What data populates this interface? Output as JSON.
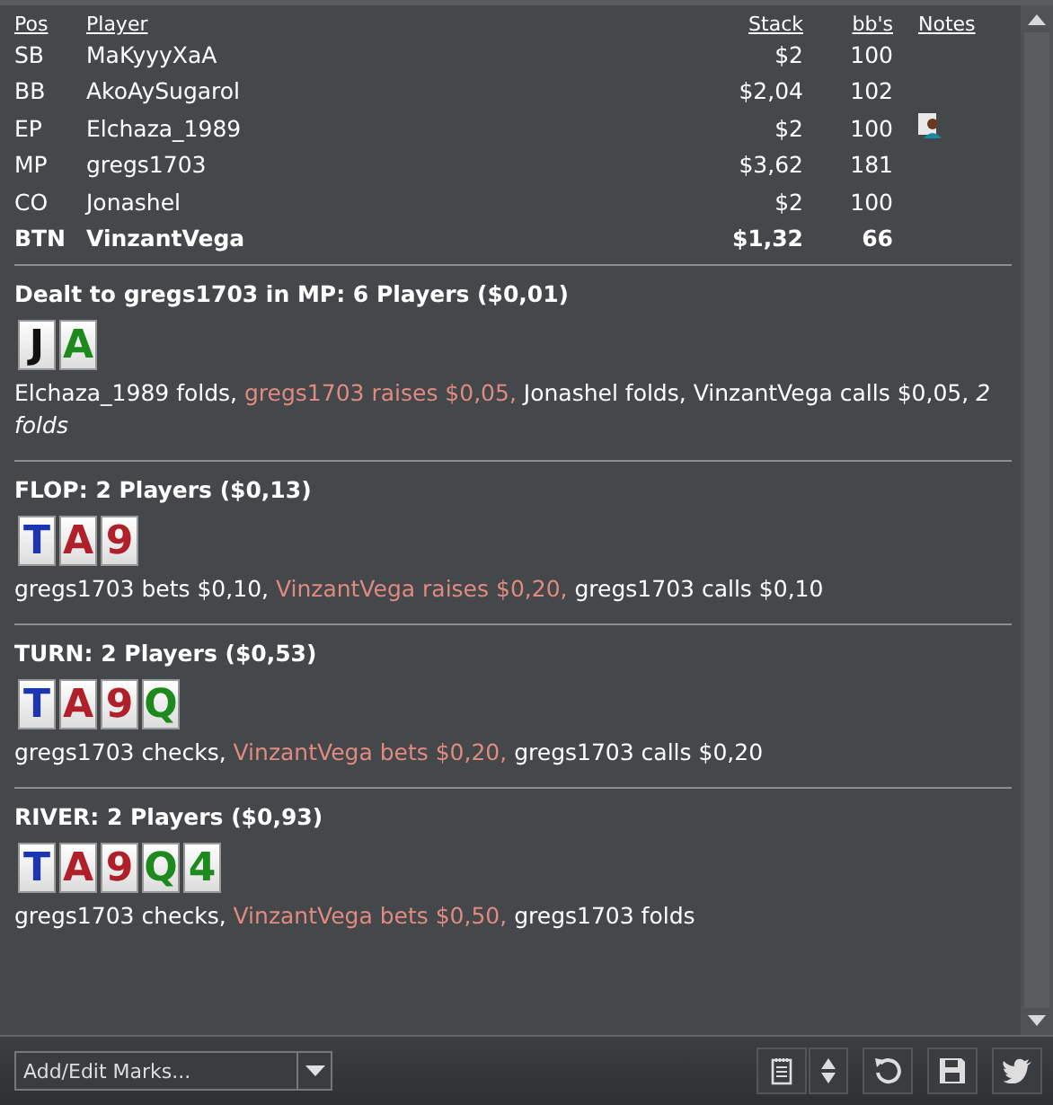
{
  "players": {
    "columns": [
      "Pos",
      "Player",
      "Stack",
      "bb's",
      "Notes"
    ],
    "rows": [
      {
        "pos": "SB",
        "player": "MaKyyyXaA",
        "stack": "$2",
        "bbs": "100",
        "has_note": false,
        "bold": false
      },
      {
        "pos": "BB",
        "player": "AkoAySugarol",
        "stack": "$2,04",
        "bbs": "102",
        "has_note": false,
        "bold": false
      },
      {
        "pos": "EP",
        "player": "Elchaza_1989",
        "stack": "$2",
        "bbs": "100",
        "has_note": true,
        "bold": false
      },
      {
        "pos": "MP",
        "player": "gregs1703",
        "stack": "$3,62",
        "bbs": "181",
        "has_note": false,
        "bold": false
      },
      {
        "pos": "CO",
        "player": "Jonashel",
        "stack": "$2",
        "bbs": "100",
        "has_note": false,
        "bold": false
      },
      {
        "pos": "BTN",
        "player": "VinzantVega",
        "stack": "$1,32",
        "bbs": "66",
        "has_note": false,
        "bold": true
      }
    ]
  },
  "streets": [
    {
      "title": "Dealt to gregs1703 in MP: 6 Players ($0,01)",
      "cards": [
        {
          "rank": "J",
          "color": "#111111"
        },
        {
          "rank": "A",
          "color": "#1e8a1e"
        }
      ],
      "actions": [
        {
          "text": "Elchaza_1989 folds, ",
          "kind": "plain"
        },
        {
          "text": "gregs1703 raises $0,05,",
          "kind": "hero"
        },
        {
          "text": " Jonashel folds, VinzantVega calls $0,05, ",
          "kind": "plain"
        },
        {
          "text": "2 folds",
          "kind": "summary"
        }
      ]
    },
    {
      "title": "FLOP: 2 Players ($0,13)",
      "cards": [
        {
          "rank": "T",
          "color": "#1a36b0"
        },
        {
          "rank": "A",
          "color": "#b0202a"
        },
        {
          "rank": "9",
          "color": "#b0202a"
        }
      ],
      "actions": [
        {
          "text": "gregs1703 bets $0,10, ",
          "kind": "plain"
        },
        {
          "text": "VinzantVega raises $0,20,",
          "kind": "hero"
        },
        {
          "text": " gregs1703 calls $0,10",
          "kind": "plain"
        }
      ]
    },
    {
      "title": "TURN: 2 Players ($0,53)",
      "cards": [
        {
          "rank": "T",
          "color": "#1a36b0"
        },
        {
          "rank": "A",
          "color": "#b0202a"
        },
        {
          "rank": "9",
          "color": "#b0202a"
        },
        {
          "rank": "Q",
          "color": "#1e8a1e"
        }
      ],
      "actions": [
        {
          "text": "gregs1703 checks, ",
          "kind": "plain"
        },
        {
          "text": "VinzantVega bets $0,20,",
          "kind": "hero"
        },
        {
          "text": " gregs1703 calls $0,20",
          "kind": "plain"
        }
      ]
    },
    {
      "title": "RIVER: 2 Players ($0,93)",
      "cards": [
        {
          "rank": "T",
          "color": "#1a36b0"
        },
        {
          "rank": "A",
          "color": "#b0202a"
        },
        {
          "rank": "9",
          "color": "#b0202a"
        },
        {
          "rank": "Q",
          "color": "#1e8a1e"
        },
        {
          "rank": "4",
          "color": "#1e8a1e"
        }
      ],
      "actions": [
        {
          "text": "gregs1703 checks, ",
          "kind": "plain"
        },
        {
          "text": "VinzantVega bets $0,50,",
          "kind": "hero"
        },
        {
          "text": " gregs1703 folds",
          "kind": "plain"
        }
      ]
    }
  ],
  "toolbar": {
    "marks_placeholder": "Add/Edit Marks..."
  }
}
